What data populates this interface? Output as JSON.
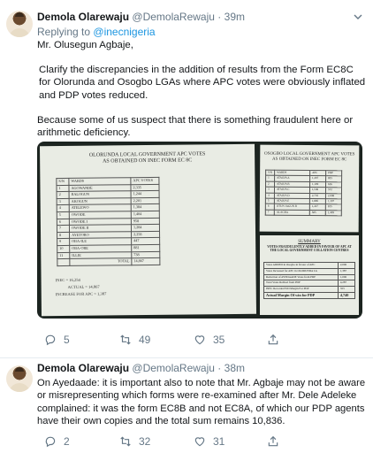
{
  "tweets": [
    {
      "author": "Demola Olarewaju",
      "handle": "@DemolaRewaju",
      "separator": "·",
      "time": "39m",
      "reply_prefix": "Replying to",
      "reply_to": "@inecnigeria",
      "paragraphs": [
        "Mr. Olusegun Agbaje,",
        "Clarify the discrepancies in the addition of results from the Form EC8C for Olorunda and Osogbo LGAs where APC votes were obviously inflated and PDP votes reduced.",
        "Because some of us suspect that there is something fraudulent here or arithmetic deficiency."
      ],
      "counts": {
        "replies": "5",
        "retweets": "49",
        "likes": "35"
      }
    },
    {
      "author": "Demola Olarewaju",
      "handle": "@DemolaRewaju",
      "separator": "·",
      "time": "38m",
      "paragraphs": [
        "On Ayedaade: it is important also to note that Mr. Agbaje may not be aware or misrepresenting which forms were re-examined after Mr. Dele Adeleke complained: it was the form EC8B and not EC8A, of which our PDP agents have their own copies and the total sum remains 10,836."
      ],
      "counts": {
        "replies": "2",
        "retweets": "32",
        "likes": "31"
      }
    }
  ],
  "media": {
    "olorunda": {
      "title_line1": "OLORUNDA LOCAL GOVERNMENT APC VOTES",
      "title_line2": "AS OBTAINED ON INEC FORM EC 8C",
      "headers": [
        "S/N",
        "WARDS",
        "APC VOTES"
      ],
      "rows": [
        [
          "1",
          "AGOWANDE",
          "2,335"
        ],
        [
          "2",
          "BALOGUN",
          "1,244"
        ],
        [
          "3",
          "AKOGUN",
          "2,201"
        ],
        [
          "4",
          "ATELEWO",
          "1,384"
        ],
        [
          "5",
          "OWODE",
          "1,404"
        ],
        [
          "6",
          "OWODE I",
          "958"
        ],
        [
          "7",
          "OWODE II",
          "1,284"
        ],
        [
          "8",
          "AYETORO",
          "2,258"
        ],
        [
          "9",
          "OBA-ILE",
          "447"
        ],
        [
          "10",
          "OBA-ORE",
          "881"
        ],
        [
          "11",
          "ILLIE",
          "738"
        ]
      ],
      "total_label": "TOTAL",
      "total_value": "14,867",
      "notes": [
        "INEC = 16,254",
        "ACTUAL = 14,867",
        "INCREASE FOR APC = 1,387"
      ]
    },
    "osogbo": {
      "title_line1": "OSOGBO LOCAL GOVERNMENT APC VOTES",
      "title_line2": "AS OBTAINED ON INEC FORM EC 8C",
      "headers": [
        "S/N",
        "WARDS",
        "APC",
        "PDP"
      ],
      "rows": [
        [
          "1",
          "ATAOJA A",
          "1,497",
          "825"
        ],
        [
          "2",
          "ATAOJA B",
          "1,109",
          "656"
        ],
        [
          "3",
          "ATAOJA C",
          "1,546",
          "572"
        ],
        [
          "4",
          "ATAOJA D",
          "2,735",
          "2,098"
        ],
        [
          "5",
          "ATAOJA E",
          "1,885",
          "1,397"
        ],
        [
          "6",
          "OTUN JAGUN B",
          "1,227",
          "815"
        ],
        [
          "7",
          "ALAGBA",
          "585",
          "1,409"
        ]
      ]
    },
    "summary": {
      "title": "SUMMARY",
      "heading": "VOTES FRAUDULENTLY ADDED IN FAVOUR OF APC AT THE LOCAL GOVERNMENT COLLATION CENTRES",
      "rows": [
        [
          "Votes ADDED in Osogbo in favour of APC",
          "2,006"
        ],
        [
          "Votes Increased for APC in OLORUNDA LG",
          "1,387"
        ],
        [
          "Reduction of AYEDAADE Votes from PDP",
          "1,006"
        ],
        [
          "Total Votes Robbed from PDP",
          "4,287"
        ],
        [
          "INEC Recorded WD Margin For PDP",
          "353"
        ]
      ],
      "margin_label": "Actual Margin Of win for PDP",
      "margin_value": "4,740"
    }
  },
  "icons": {
    "avatar": "avatar-icon",
    "caret": "chevron-down-icon",
    "reply": "reply-icon",
    "retweet": "retweet-icon",
    "like": "heart-icon",
    "share": "share-icon"
  },
  "colors": {
    "link": "#1b95e0",
    "muted": "#657786",
    "text": "#14171a"
  }
}
